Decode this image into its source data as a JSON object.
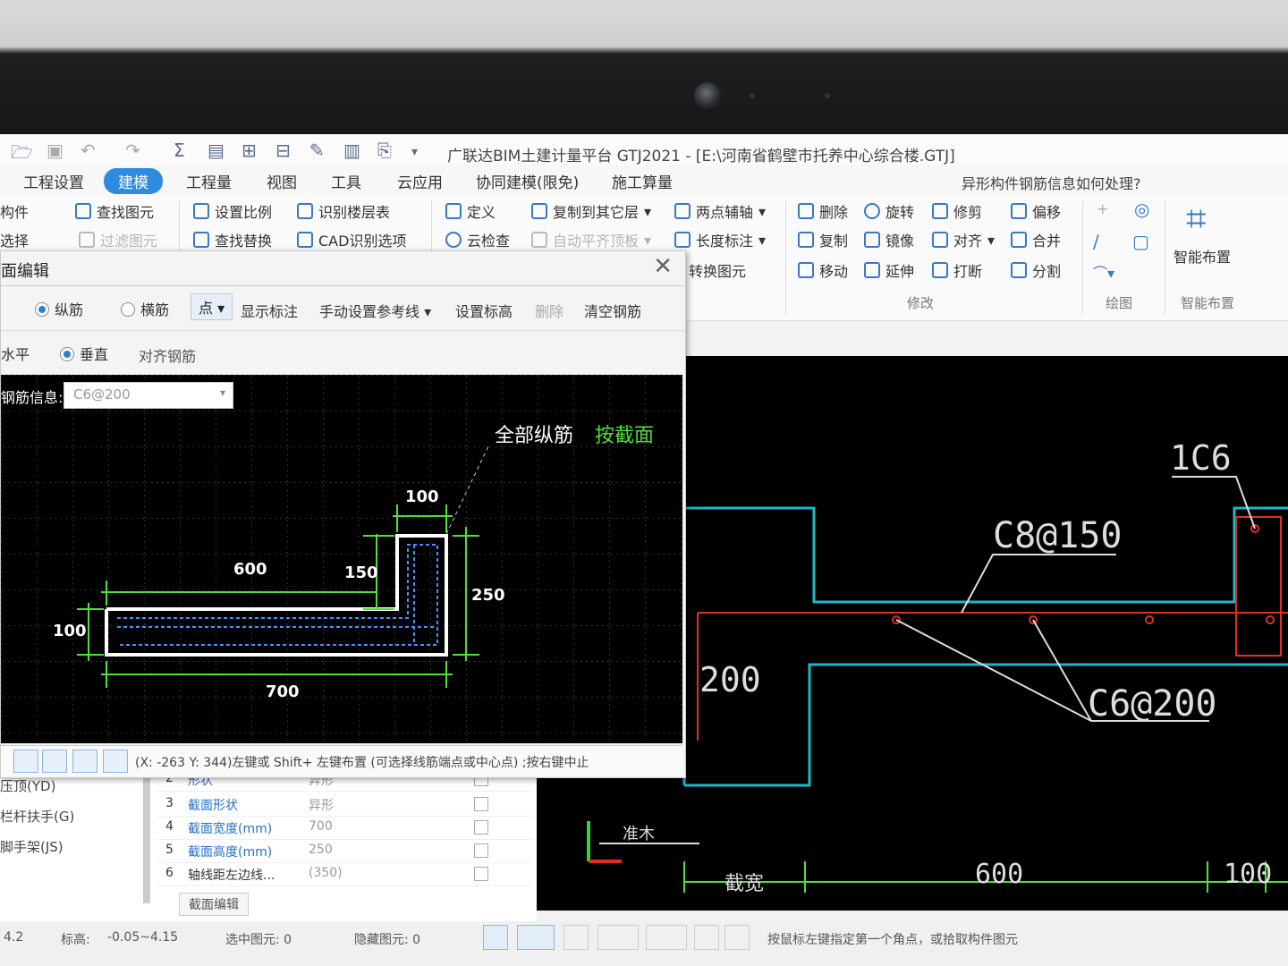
{
  "window_title": "广联达BIM土建计量平台 GTJ2021 - [E:\\河南省鹤壁市托养中心综合楼.GTJ]",
  "menu": [
    "工程设置",
    "建模",
    "工程量",
    "视图",
    "工具",
    "云应用",
    "协同建模(限免)",
    "施工算量"
  ],
  "menu_active": "建模",
  "help_hint": "异形构件钢筋信息如何处理?",
  "ribbon": {
    "col1": [
      "构件",
      "选择"
    ],
    "col2": [
      "查找图元",
      "过滤图元"
    ],
    "col3": [
      "设置比例",
      "查找替换"
    ],
    "col4": [
      "识别楼层表",
      "CAD识别选项"
    ],
    "col5": [
      "定义",
      "云检查"
    ],
    "col6": [
      "复制到其它层",
      "自动平齐顶板"
    ],
    "col7": [
      "两点辅轴",
      "长度标注",
      "转换图元"
    ],
    "modify": [
      "删除",
      "旋转",
      "修剪",
      "偏移",
      "复制",
      "镜像",
      "对齐",
      "合并",
      "移动",
      "延伸",
      "打断",
      "分割"
    ],
    "groups": {
      "modify": "修改",
      "draw": "绘图",
      "smart": "智能布置"
    },
    "smart_button": "智能布置"
  },
  "dialog": {
    "title": "面编辑",
    "radio1": "纵筋",
    "radio2": "横筋",
    "point_btn": "点",
    "tools": [
      "显示标注",
      "手动设置参考线",
      "设置标高",
      "删除",
      "清空钢筋"
    ],
    "row2_left": "水平",
    "radio3": "垂直",
    "align": "对齐钢筋",
    "rebar_label": "钢筋信息:",
    "rebar_value": "C6@200",
    "canvas_all": "全部纵筋",
    "canvas_section": "按截面",
    "dims": {
      "top": "100",
      "left_len": "600",
      "inner": "150",
      "right_h": "250",
      "left_h": "100",
      "bottom": "700"
    },
    "coord_status": "(X: -263 Y: 344)左键或 Shift+ 左键布置 (可选择线筋端点或中心点) ;按右键中止"
  },
  "cad": {
    "label_1c6": "1C6",
    "label_c8": "C8@150",
    "label_c6": "C6@200",
    "label_200": "200",
    "label_600": "600",
    "label_100": "100",
    "label_bottom_left": "截宽",
    "label_under": "准木"
  },
  "left_panel": {
    "items": [
      "压顶(YD)",
      "栏杆扶手(G)",
      "脚手架(JS)"
    ],
    "props": [
      {
        "num": "2",
        "name": "形状",
        "value": "异形"
      },
      {
        "num": "3",
        "name": "截面形状",
        "value": "异形"
      },
      {
        "num": "4",
        "name": "截面宽度(mm)",
        "value": "700"
      },
      {
        "num": "5",
        "name": "截面高度(mm)",
        "value": "250"
      },
      {
        "num": "6",
        "name": "轴线距左边线...",
        "value": "(350)"
      }
    ],
    "section_edit": "截面编辑"
  },
  "status": {
    "left": "4.2",
    "elev_label": "标高:",
    "elev_value": "-0.05~4.15",
    "selected": "选中图元: 0",
    "hidden": "隐藏图元: 0",
    "tip": "按鼠标左键指定第一个角点，或拾取构件图元"
  },
  "colors": {
    "accent": "#2f8be0",
    "cad_cyan": "#1fb6c8",
    "cad_red": "#e03020",
    "dim_green": "#50e03a"
  }
}
